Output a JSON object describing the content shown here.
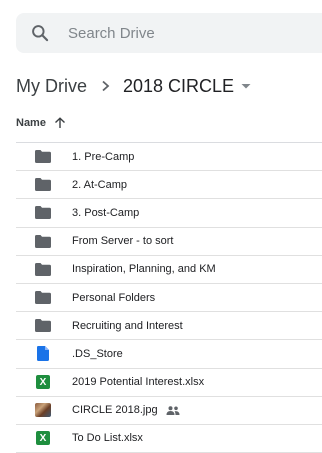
{
  "search": {
    "placeholder": "Search Drive",
    "value": ""
  },
  "breadcrumb": {
    "root": "My Drive",
    "separator": ">",
    "current": "2018 CIRCLE"
  },
  "list_header": {
    "name_label": "Name",
    "sort": "ascending"
  },
  "files": [
    {
      "name": "1. Pre-Camp",
      "icon": "folder-icon",
      "shared": false
    },
    {
      "name": "2. At-Camp",
      "icon": "folder-icon",
      "shared": false
    },
    {
      "name": "3. Post-Camp",
      "icon": "folder-icon",
      "shared": false
    },
    {
      "name": "From Server - to sort",
      "icon": "folder-icon",
      "shared": false
    },
    {
      "name": "Inspiration, Planning, and KM",
      "icon": "folder-icon",
      "shared": false
    },
    {
      "name": "Personal Folders",
      "icon": "folder-icon",
      "shared": false
    },
    {
      "name": "Recruiting and Interest",
      "icon": "folder-icon",
      "shared": false
    },
    {
      "name": ".DS_Store",
      "icon": "document-icon",
      "shared": false
    },
    {
      "name": "2019 Potential Interest.xlsx",
      "icon": "excel-icon",
      "shared": false
    },
    {
      "name": "CIRCLE 2018.jpg",
      "icon": "image-thumbnail",
      "shared": true
    },
    {
      "name": "To Do List.xlsx",
      "icon": "excel-icon",
      "shared": false
    }
  ],
  "colors": {
    "folder": "#5f6368",
    "document": "#1a73e8",
    "excel": "#1e8e3e",
    "search_bg": "#f1f3f4"
  }
}
